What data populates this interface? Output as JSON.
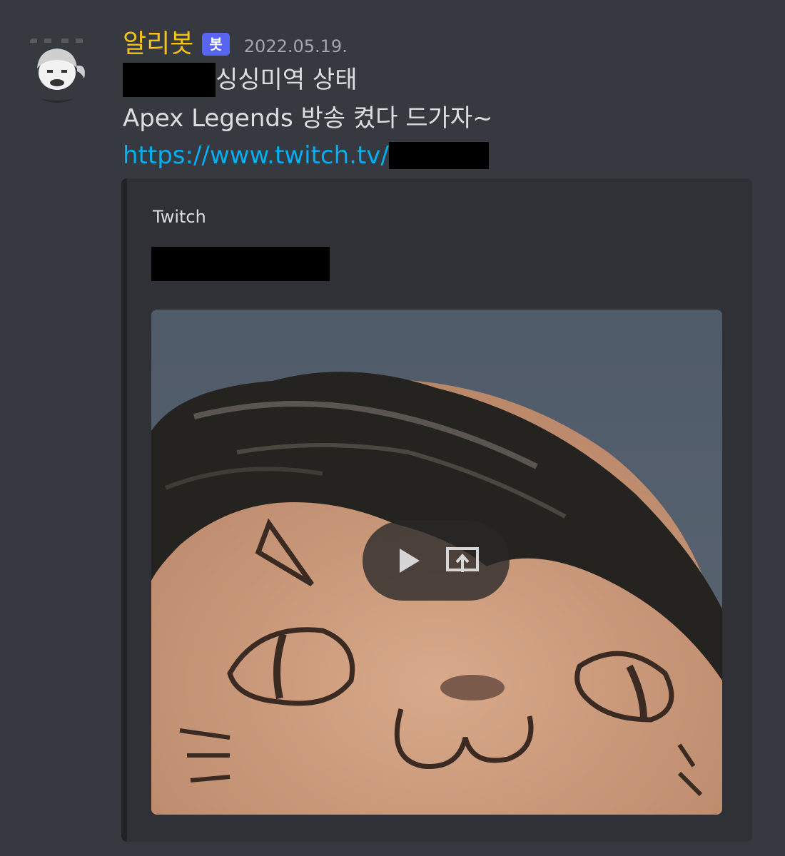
{
  "message": {
    "author": "알리봇",
    "bot_tag": "봇",
    "timestamp": "2022.05.19.",
    "line1_text": "싱싱미역 상태",
    "line2_text": "Apex Legends 방송 켰다 드가자~",
    "link_text": "https://www.twitch.tv/"
  },
  "embed": {
    "provider": "Twitch",
    "accent_color": "#202225",
    "video_controls": {
      "play_icon": "play-icon",
      "open_icon": "open-external-icon"
    }
  },
  "colors": {
    "background": "#36393f",
    "username": "#f2c416",
    "bot_tag": "#5865f2",
    "link": "#00aff4",
    "embed_bg": "#2f3136"
  }
}
